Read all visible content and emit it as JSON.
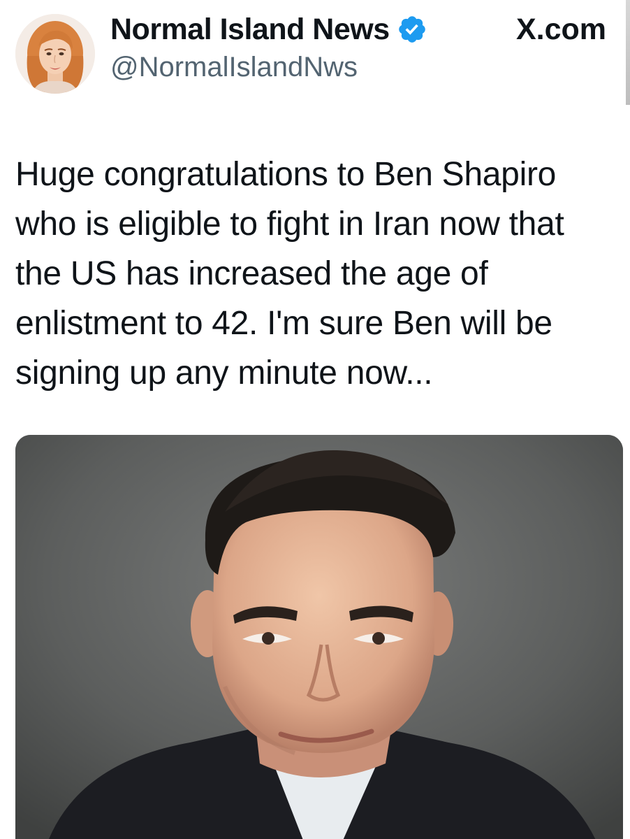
{
  "post": {
    "display_name": "Normal Island News",
    "handle": "@NormalIslandNws",
    "site": "X.com",
    "verified_icon": "verified-badge-icon",
    "avatar_icon": "avatar",
    "text_lines": [
      "Huge congratulations to Ben Shapiro",
      "who is eligible to fight in Iran now that",
      "the US has increased the age of",
      "enlistment to 42. I'm sure Ben will be",
      "signing up any minute now..."
    ],
    "media": "portrait-photo"
  },
  "colors": {
    "text": "#0f1419",
    "secondary_text": "#536471",
    "verified_blue": "#1d9bf0",
    "photo_background": "#5f6160"
  }
}
